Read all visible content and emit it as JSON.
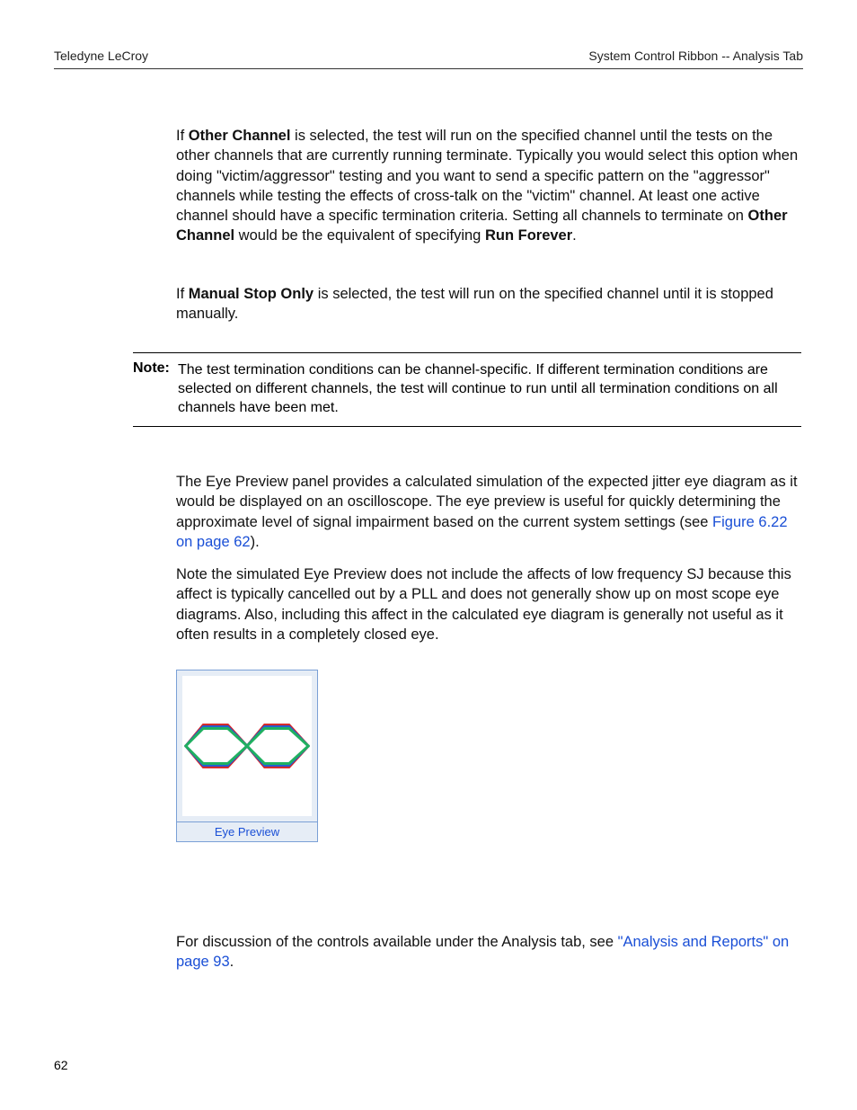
{
  "header": {
    "left": "Teledyne LeCroy",
    "right": "System Control Ribbon -- Analysis Tab"
  },
  "section1": {
    "p1_pre": "If ",
    "p1_b1": "Other Channel",
    "p1_mid": " is selected, the test will run on the specified channel until the tests on the other channels that are currently running terminate. Typically you would select this option when doing \"victim/aggressor\" testing and you want to send a specific pattern on the \"aggressor\" channels while testing the effects of cross-talk on the \"victim\" channel. At least one active channel should have a specific termination criteria. Setting all channels to terminate on ",
    "p1_b2": "Other Channel",
    "p1_mid2": " would be the equivalent of specifying ",
    "p1_b3": "Run Forever",
    "p1_end": ".",
    "p2_pre": "If ",
    "p2_b1": "Manual Stop Only",
    "p2_end": " is selected, the test will run on the specified channel until it is stopped manually."
  },
  "note": {
    "label": "Note:",
    "text": "The test termination conditions can be channel-specific. If different termination conditions are selected on different channels, the test will continue to run until all termination conditions on all channels have been met."
  },
  "section2": {
    "p3_pre": "The Eye Preview panel provides a calculated simulation of the expected jitter eye diagram as it would be displayed on an oscilloscope. The eye preview is useful for quickly determining the approximate level of signal impairment based on the current system settings (see ",
    "p3_link": "Figure 6.22 on page 62",
    "p3_end": ").",
    "p4": "Note the simulated Eye Preview does not include the affects of low frequency SJ because this affect is typically cancelled out by a PLL and does not generally show up on most scope eye diagrams. Also, including this affect in the calculated eye diagram is generally not useful as it often results in a completely closed eye.",
    "p5_pre": "For discussion of the controls available under the Analysis tab, see ",
    "p5_link": "\"Analysis and Reports\" on page 93",
    "p5_end": "."
  },
  "figure": {
    "label": "Eye Preview"
  },
  "page_number": "62"
}
